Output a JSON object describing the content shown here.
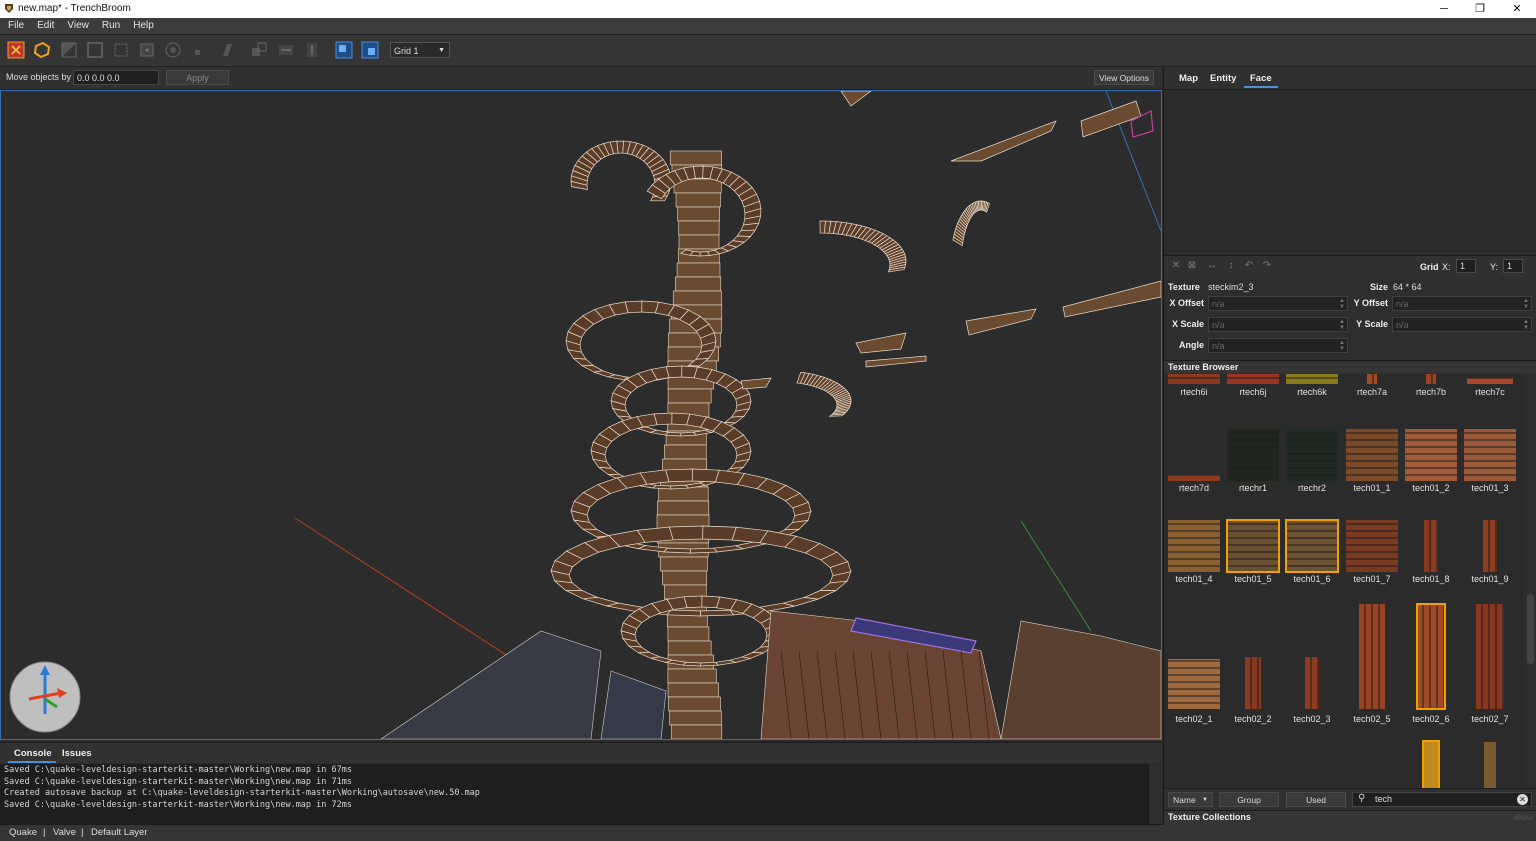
{
  "window": {
    "title": "new.map* - TrenchBroom",
    "controls": [
      "─",
      "❐",
      "✕"
    ]
  },
  "menu": [
    "File",
    "Edit",
    "View",
    "Run",
    "Help"
  ],
  "toolbar": {
    "grid_value": "Grid 1"
  },
  "movebar": {
    "label": "Move objects by",
    "value": "0.0 0.0 0.0",
    "apply_label": "Apply",
    "view_options_label": "View Options"
  },
  "console": {
    "tabs": [
      "Console",
      "Issues"
    ],
    "lines": [
      "Saved C:\\quake-leveldesign-starterkit-master\\Working\\new.map in 67ms",
      "Saved C:\\quake-leveldesign-starterkit-master\\Working\\new.map in 71ms",
      "Created autosave backup at C:\\quake-leveldesign-starterkit-master\\Working\\autosave\\new.50.map",
      "Saved C:\\quake-leveldesign-starterkit-master\\Working\\new.map in 72ms"
    ]
  },
  "statusbar": {
    "game": "Quake",
    "sep": "|",
    "format": "Valve",
    "layer": "Default Layer"
  },
  "inspector": {
    "tabs": [
      "Map",
      "Entity",
      "Face"
    ],
    "active_tab": "Face",
    "grid": {
      "label": "Grid",
      "x_label": "X:",
      "x_value": "1",
      "y_label": "Y:",
      "y_value": "1"
    },
    "texture_label": "Texture",
    "texture_value": "steckim2_3",
    "size_label": "Size",
    "size_value": "64 * 64",
    "x_offset_label": "X Offset",
    "y_offset_label": "Y Offset",
    "x_scale_label": "X Scale",
    "y_scale_label": "Y Scale",
    "angle_label": "Angle",
    "na": "n/a"
  },
  "texture_browser": {
    "title": "Texture Browser",
    "textures": [
      {
        "name": "rtech6i",
        "color": "#8a3a1e",
        "selected": false
      },
      {
        "name": "rtech6j",
        "color": "#9a3424",
        "selected": false
      },
      {
        "name": "rtech6k",
        "color": "#8a7a1e",
        "selected": false
      },
      {
        "name": "rtech7a",
        "color": "#a24a22",
        "selected": false
      },
      {
        "name": "rtech7b",
        "color": "#9a4422",
        "selected": false
      },
      {
        "name": "rtech7c",
        "color": "#a8482a",
        "selected": false
      },
      {
        "name": "rtech7d",
        "color": "#8c3a1e",
        "selected": false
      },
      {
        "name": "rtechr1",
        "color": "#20261e",
        "selected": false
      },
      {
        "name": "rtechr2",
        "color": "#1e2a22",
        "selected": false
      },
      {
        "name": "tech01_1",
        "color": "#7a4a2a",
        "selected": false
      },
      {
        "name": "tech01_2",
        "color": "#a05a3a",
        "selected": false
      },
      {
        "name": "tech01_3",
        "color": "#9a5a3a",
        "selected": false
      },
      {
        "name": "tech01_4",
        "color": "#8a6030",
        "selected": false
      },
      {
        "name": "tech01_5",
        "color": "#6a5030",
        "selected": true
      },
      {
        "name": "tech01_6",
        "color": "#6e5232",
        "selected": true
      },
      {
        "name": "tech01_7",
        "color": "#7a3a22",
        "selected": false
      },
      {
        "name": "tech01_8",
        "color": "#8a3a20",
        "selected": false
      },
      {
        "name": "tech01_9",
        "color": "#8e3e22",
        "selected": false
      },
      {
        "name": "tech02_1",
        "color": "#a06a40",
        "selected": false
      },
      {
        "name": "tech02_2",
        "color": "#8a3a20",
        "selected": false
      },
      {
        "name": "tech02_3",
        "color": "#8e3c22",
        "selected": false
      },
      {
        "name": "tech02_5",
        "color": "#9a4224",
        "selected": false
      },
      {
        "name": "tech02_6",
        "color": "#a04a26",
        "selected": true
      },
      {
        "name": "tech02_7",
        "color": "#8a3620",
        "selected": false
      }
    ],
    "footer": {
      "sort_label": "Name",
      "group_label": "Group",
      "used_label": "Used",
      "search_value": "tech"
    },
    "collections_label": "Texture Collections",
    "collections_hint": "show"
  },
  "colors": {
    "accent": "#4a8fd8",
    "selection": "#f0a000",
    "wire": "#e8dcc8"
  }
}
